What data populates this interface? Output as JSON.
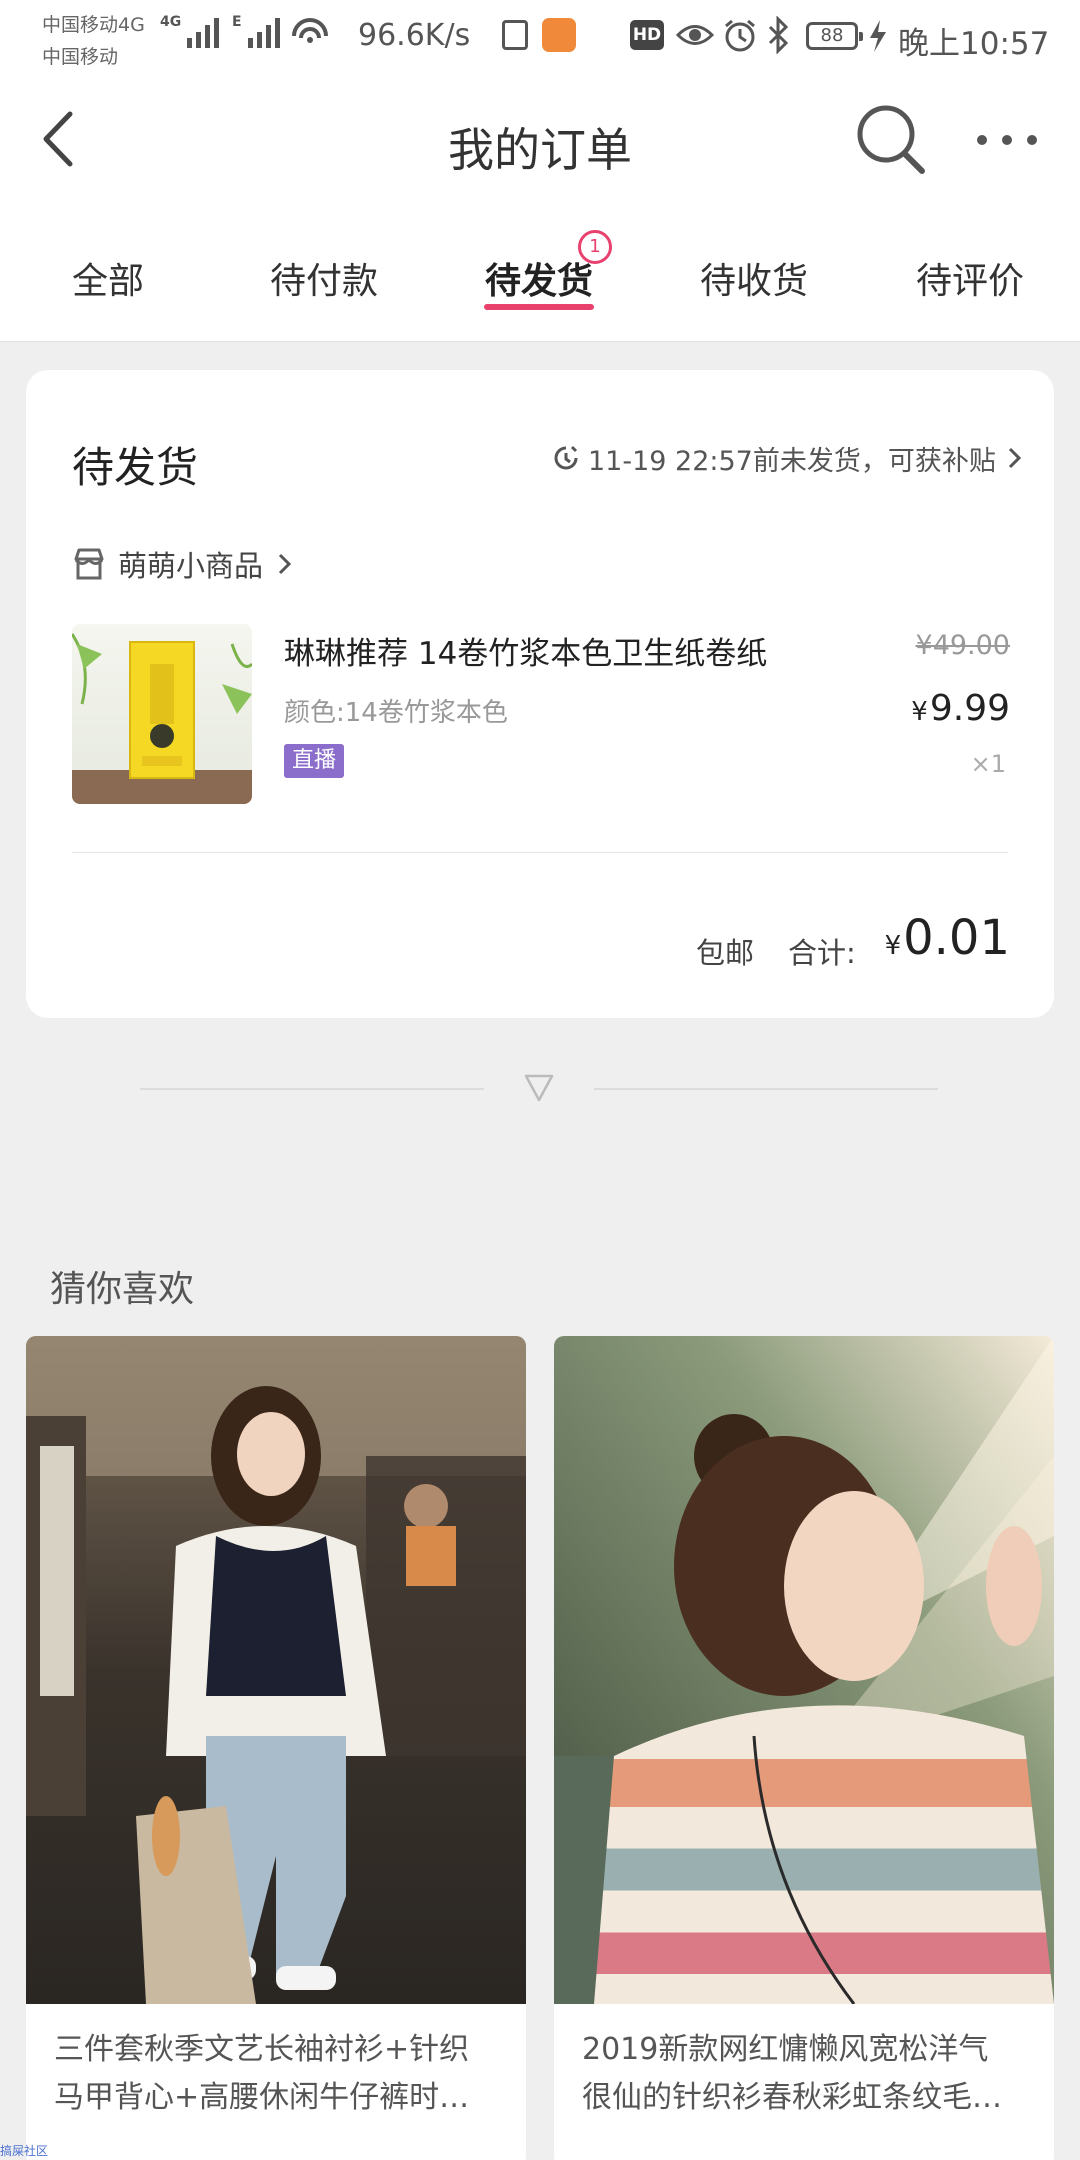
{
  "status_bar": {
    "carrier_1": "中国移动4G",
    "carrier_2": "中国移动",
    "net_speed": "96.6K/s",
    "hd_label": "HD",
    "battery": "88",
    "time": "晚上10:57",
    "icons": [
      "signal-icon",
      "wifi-icon",
      "document-icon",
      "mi-app-icon",
      "hd-icon",
      "eye-icon",
      "alarm-icon",
      "bluetooth-icon",
      "battery-icon",
      "charging-icon"
    ]
  },
  "header": {
    "title": "我的订单",
    "icons": [
      "back-icon",
      "search-icon",
      "more-icon"
    ]
  },
  "tabs": [
    {
      "label": "全部"
    },
    {
      "label": "待付款"
    },
    {
      "label": "待发货",
      "badge": "1",
      "active": true
    },
    {
      "label": "待收货"
    },
    {
      "label": "待评价"
    }
  ],
  "order": {
    "status": "待发货",
    "ship_hint": "11-19 22:57前未发货，可获补贴",
    "shop_name": "萌萌小商品",
    "product": {
      "name": "琳琳推荐 14卷竹浆本色卫生纸卷纸",
      "spec": "颜色:14卷竹浆本色",
      "tag": "直播",
      "original_price": "¥49.00",
      "currency": "¥",
      "price": "9.99",
      "quantity": "×1"
    },
    "shipping": "包邮",
    "total_label": "合计:",
    "total_currency": "¥",
    "total": "0.01"
  },
  "recommend": {
    "title": "猜你喜欢",
    "items": [
      {
        "line1": "三件套秋季文艺长袖衬衫+针织",
        "line2": "马甲背心+高腰休闲牛仔裤时…"
      },
      {
        "line1": "2019新款网红慵懒风宽松洋气",
        "line2": "很仙的针织衫春秋彩虹条纹毛…"
      }
    ]
  },
  "watermark": "搞屎社区",
  "colors": {
    "accent": "#e8416e",
    "live_tag": "#8b6dcc",
    "background": "#efefef"
  }
}
